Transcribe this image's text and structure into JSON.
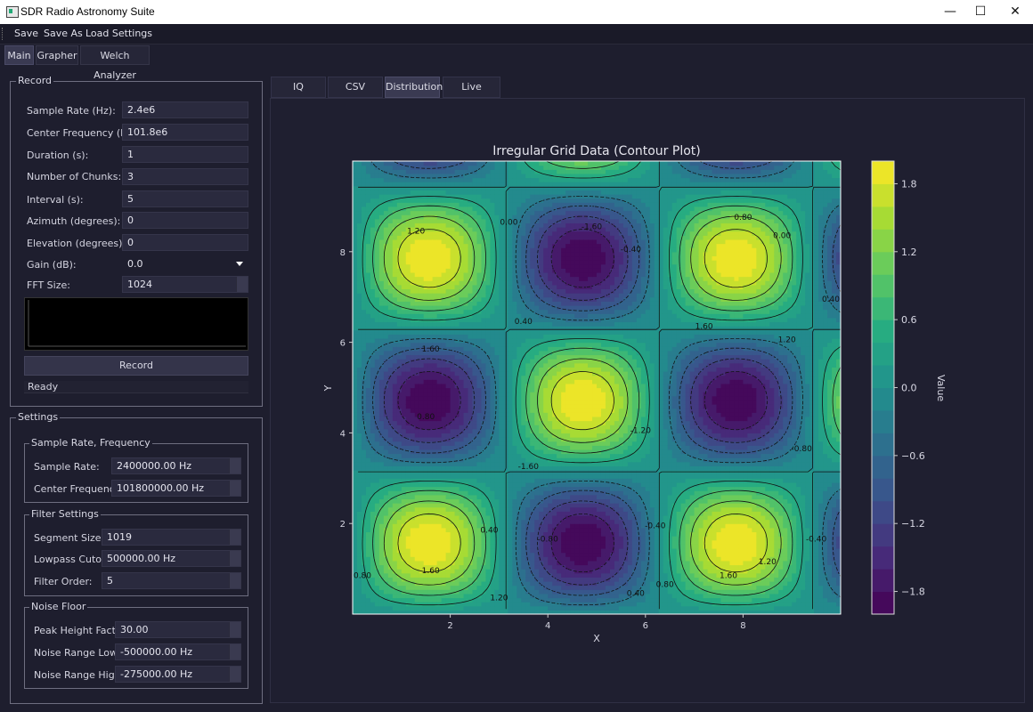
{
  "window": {
    "title": "SDR Radio Astronomy Suite",
    "minimize": "—",
    "maximize": "☐",
    "close": "✕"
  },
  "menu": [
    "Save",
    "Save As",
    "Load Settings"
  ],
  "main_tabs": [
    "Main",
    "Grapher",
    "Welch Analyzer"
  ],
  "record": {
    "title": "Record",
    "fields": [
      {
        "label": "Sample Rate (Hz):",
        "value": "2.4e6"
      },
      {
        "label": "Center Frequency (Hz):",
        "value": "101.8e6"
      },
      {
        "label": "Duration (s):",
        "value": "1"
      },
      {
        "label": "Number of Chunks:",
        "value": "3"
      },
      {
        "label": "Interval (s):",
        "value": "5"
      },
      {
        "label": "Azimuth (degrees):",
        "value": "0"
      },
      {
        "label": "Elevation (degrees):",
        "value": "0"
      }
    ],
    "gain_label": "Gain (dB):",
    "gain_value": "0.0",
    "fft_label": "FFT Size:",
    "fft_value": "1024",
    "record_button": "Record",
    "status": "Ready"
  },
  "settings": {
    "title": "Settings",
    "sample_group": {
      "title": "Sample Rate, Frequency",
      "fields": [
        {
          "label": "Sample Rate:",
          "value": "2400000.00 Hz"
        },
        {
          "label": "Center Frequency:",
          "value": "101800000.00 Hz"
        }
      ]
    },
    "filter_group": {
      "title": "Filter Settings",
      "fields": [
        {
          "label": "Segment Size:",
          "value": "1019"
        },
        {
          "label": "Lowpass Cutoff:",
          "value": "500000.00 Hz"
        },
        {
          "label": "Filter Order:",
          "value": "5"
        }
      ]
    },
    "noise_group": {
      "title": "Noise Floor",
      "fields": [
        {
          "label": "Peak Height Factor:",
          "value": "30.00"
        },
        {
          "label": "Noise Range Low:",
          "value": "-500000.00 Hz"
        },
        {
          "label": "Noise Range High:",
          "value": "-275000.00 Hz"
        }
      ]
    }
  },
  "sub_tabs": [
    "IQ Analyzer",
    "CSV Viewer",
    "Distribution",
    "Live Preview"
  ],
  "chart_data": {
    "type": "heatmap",
    "title": "Irregular Grid Data (Contour Plot)",
    "xlabel": "X",
    "ylabel": "Y",
    "colorbar_label": "Value",
    "xlim": [
      0,
      10
    ],
    "ylim": [
      0,
      10
    ],
    "x_ticks": [
      2,
      4,
      6,
      8
    ],
    "y_ticks": [
      2,
      4,
      6,
      8
    ],
    "colorbar_ticks": [
      "1.8",
      "1.2",
      "0.6",
      "0.0",
      "−0.6",
      "−1.2",
      "−1.8"
    ],
    "colorbar_range": [
      -2.0,
      2.0
    ],
    "colormap": "viridis",
    "function": "2*sin(x)*sin(y)",
    "contour_labels": [
      {
        "text": "1.20",
        "x": 1.3,
        "y": 8.4
      },
      {
        "text": "0.00",
        "x": 3.2,
        "y": 8.6
      },
      {
        "text": "-1.60",
        "x": 4.9,
        "y": 8.5
      },
      {
        "text": "0.80",
        "x": 8.0,
        "y": 8.7
      },
      {
        "text": "0.00",
        "x": 8.8,
        "y": 8.3
      },
      {
        "text": "-0.40",
        "x": 5.7,
        "y": 8.0
      },
      {
        "text": "0.40",
        "x": 3.5,
        "y": 6.4
      },
      {
        "text": "1.60",
        "x": 1.6,
        "y": 5.8
      },
      {
        "text": "1.60",
        "x": 7.2,
        "y": 6.3
      },
      {
        "text": "1.20",
        "x": 8.9,
        "y": 6.0
      },
      {
        "text": "0.40",
        "x": 9.8,
        "y": 6.9
      },
      {
        "text": "0.80",
        "x": 1.5,
        "y": 4.3
      },
      {
        "text": "-1.20",
        "x": 5.9,
        "y": 4.0
      },
      {
        "text": "-1.60",
        "x": 3.6,
        "y": 3.2
      },
      {
        "text": "-0.80",
        "x": 9.2,
        "y": 3.6
      },
      {
        "text": "0.40",
        "x": 2.8,
        "y": 1.8
      },
      {
        "text": "-0.80",
        "x": 4.0,
        "y": 1.6
      },
      {
        "text": "-0.40",
        "x": 6.2,
        "y": 1.9
      },
      {
        "text": "-0.40",
        "x": 9.5,
        "y": 1.6
      },
      {
        "text": "1.20",
        "x": 8.5,
        "y": 1.1
      },
      {
        "text": "1.60",
        "x": 1.6,
        "y": 0.9
      },
      {
        "text": "1.60",
        "x": 7.7,
        "y": 0.8
      },
      {
        "text": "0.80",
        "x": 6.4,
        "y": 0.6
      },
      {
        "text": "0.40",
        "x": 5.8,
        "y": 0.4
      },
      {
        "text": "0.80",
        "x": 0.2,
        "y": 0.8
      },
      {
        "text": "1.20",
        "x": 3.0,
        "y": 0.3
      }
    ]
  }
}
